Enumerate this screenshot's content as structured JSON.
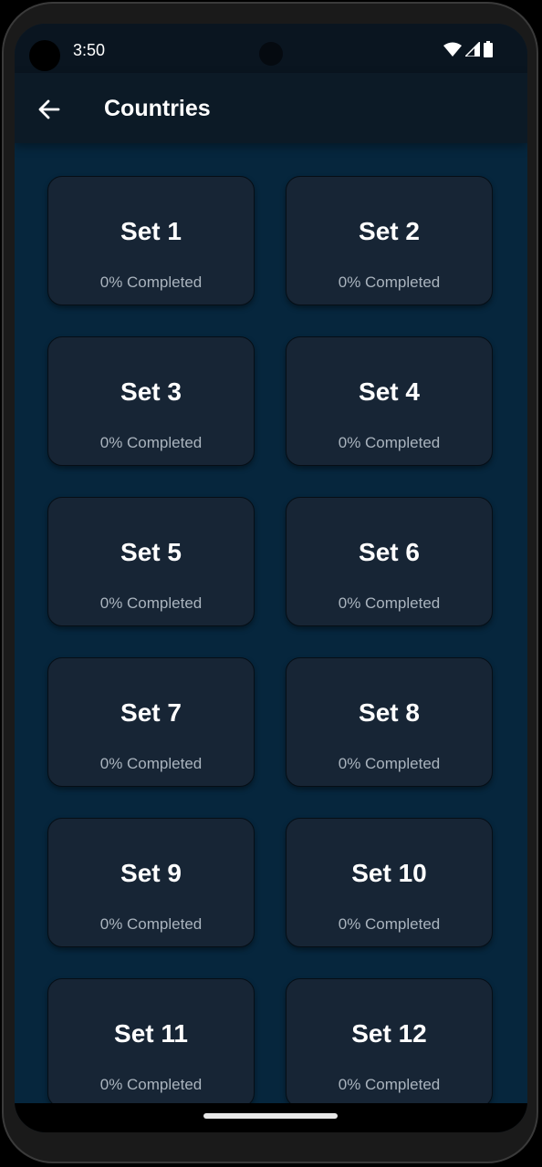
{
  "status_bar": {
    "time": "3:50",
    "icons": [
      "wifi-icon",
      "signal-icon",
      "battery-icon"
    ]
  },
  "app_bar": {
    "title": "Countries",
    "back_icon": "arrow-left-icon"
  },
  "sets": [
    {
      "name": "Set 1",
      "progress": "0% Completed"
    },
    {
      "name": "Set 2",
      "progress": "0% Completed"
    },
    {
      "name": "Set 3",
      "progress": "0% Completed"
    },
    {
      "name": "Set 4",
      "progress": "0% Completed"
    },
    {
      "name": "Set 5",
      "progress": "0% Completed"
    },
    {
      "name": "Set 6",
      "progress": "0% Completed"
    },
    {
      "name": "Set 7",
      "progress": "0% Completed"
    },
    {
      "name": "Set 8",
      "progress": "0% Completed"
    },
    {
      "name": "Set 9",
      "progress": "0% Completed"
    },
    {
      "name": "Set 10",
      "progress": "0% Completed"
    },
    {
      "name": "Set 11",
      "progress": "0% Completed"
    },
    {
      "name": "Set 12",
      "progress": "0% Completed"
    }
  ],
  "colors": {
    "background": "#06263d",
    "card": "#172535",
    "app_bar": "#0c1a26"
  }
}
